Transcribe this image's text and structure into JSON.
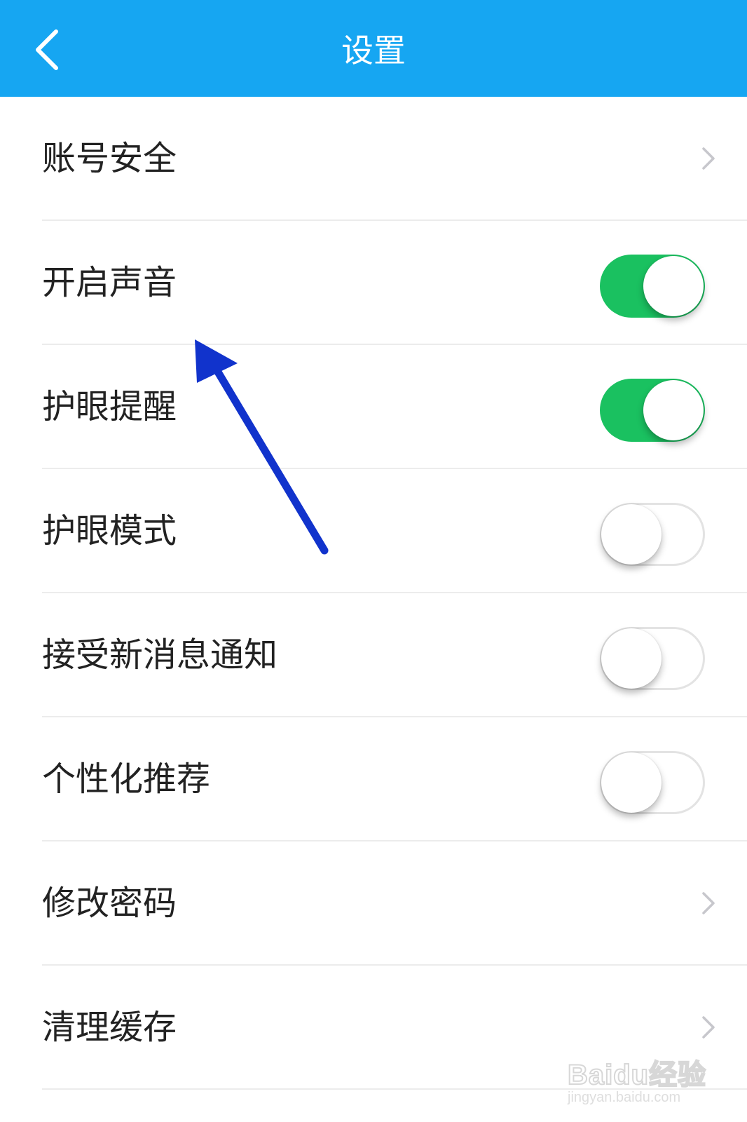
{
  "header": {
    "title": "设置",
    "back_icon": "chevron-left-icon",
    "background_color": "#16a6f2"
  },
  "settings": [
    {
      "label": "账号安全",
      "type": "link"
    },
    {
      "label": "开启声音",
      "type": "toggle",
      "on": true
    },
    {
      "label": "护眼提醒",
      "type": "toggle",
      "on": true
    },
    {
      "label": "护眼模式",
      "type": "toggle",
      "on": false
    },
    {
      "label": "接受新消息通知",
      "type": "toggle",
      "on": false
    },
    {
      "label": "个性化推荐",
      "type": "toggle",
      "on": false
    },
    {
      "label": "修改密码",
      "type": "link"
    },
    {
      "label": "清理缓存",
      "type": "link"
    }
  ],
  "colors": {
    "toggle_on": "#1ac160",
    "annotation_arrow": "#1133cc"
  },
  "watermark": {
    "logo": "Baidu经验",
    "url": "jingyan.baidu.com"
  }
}
